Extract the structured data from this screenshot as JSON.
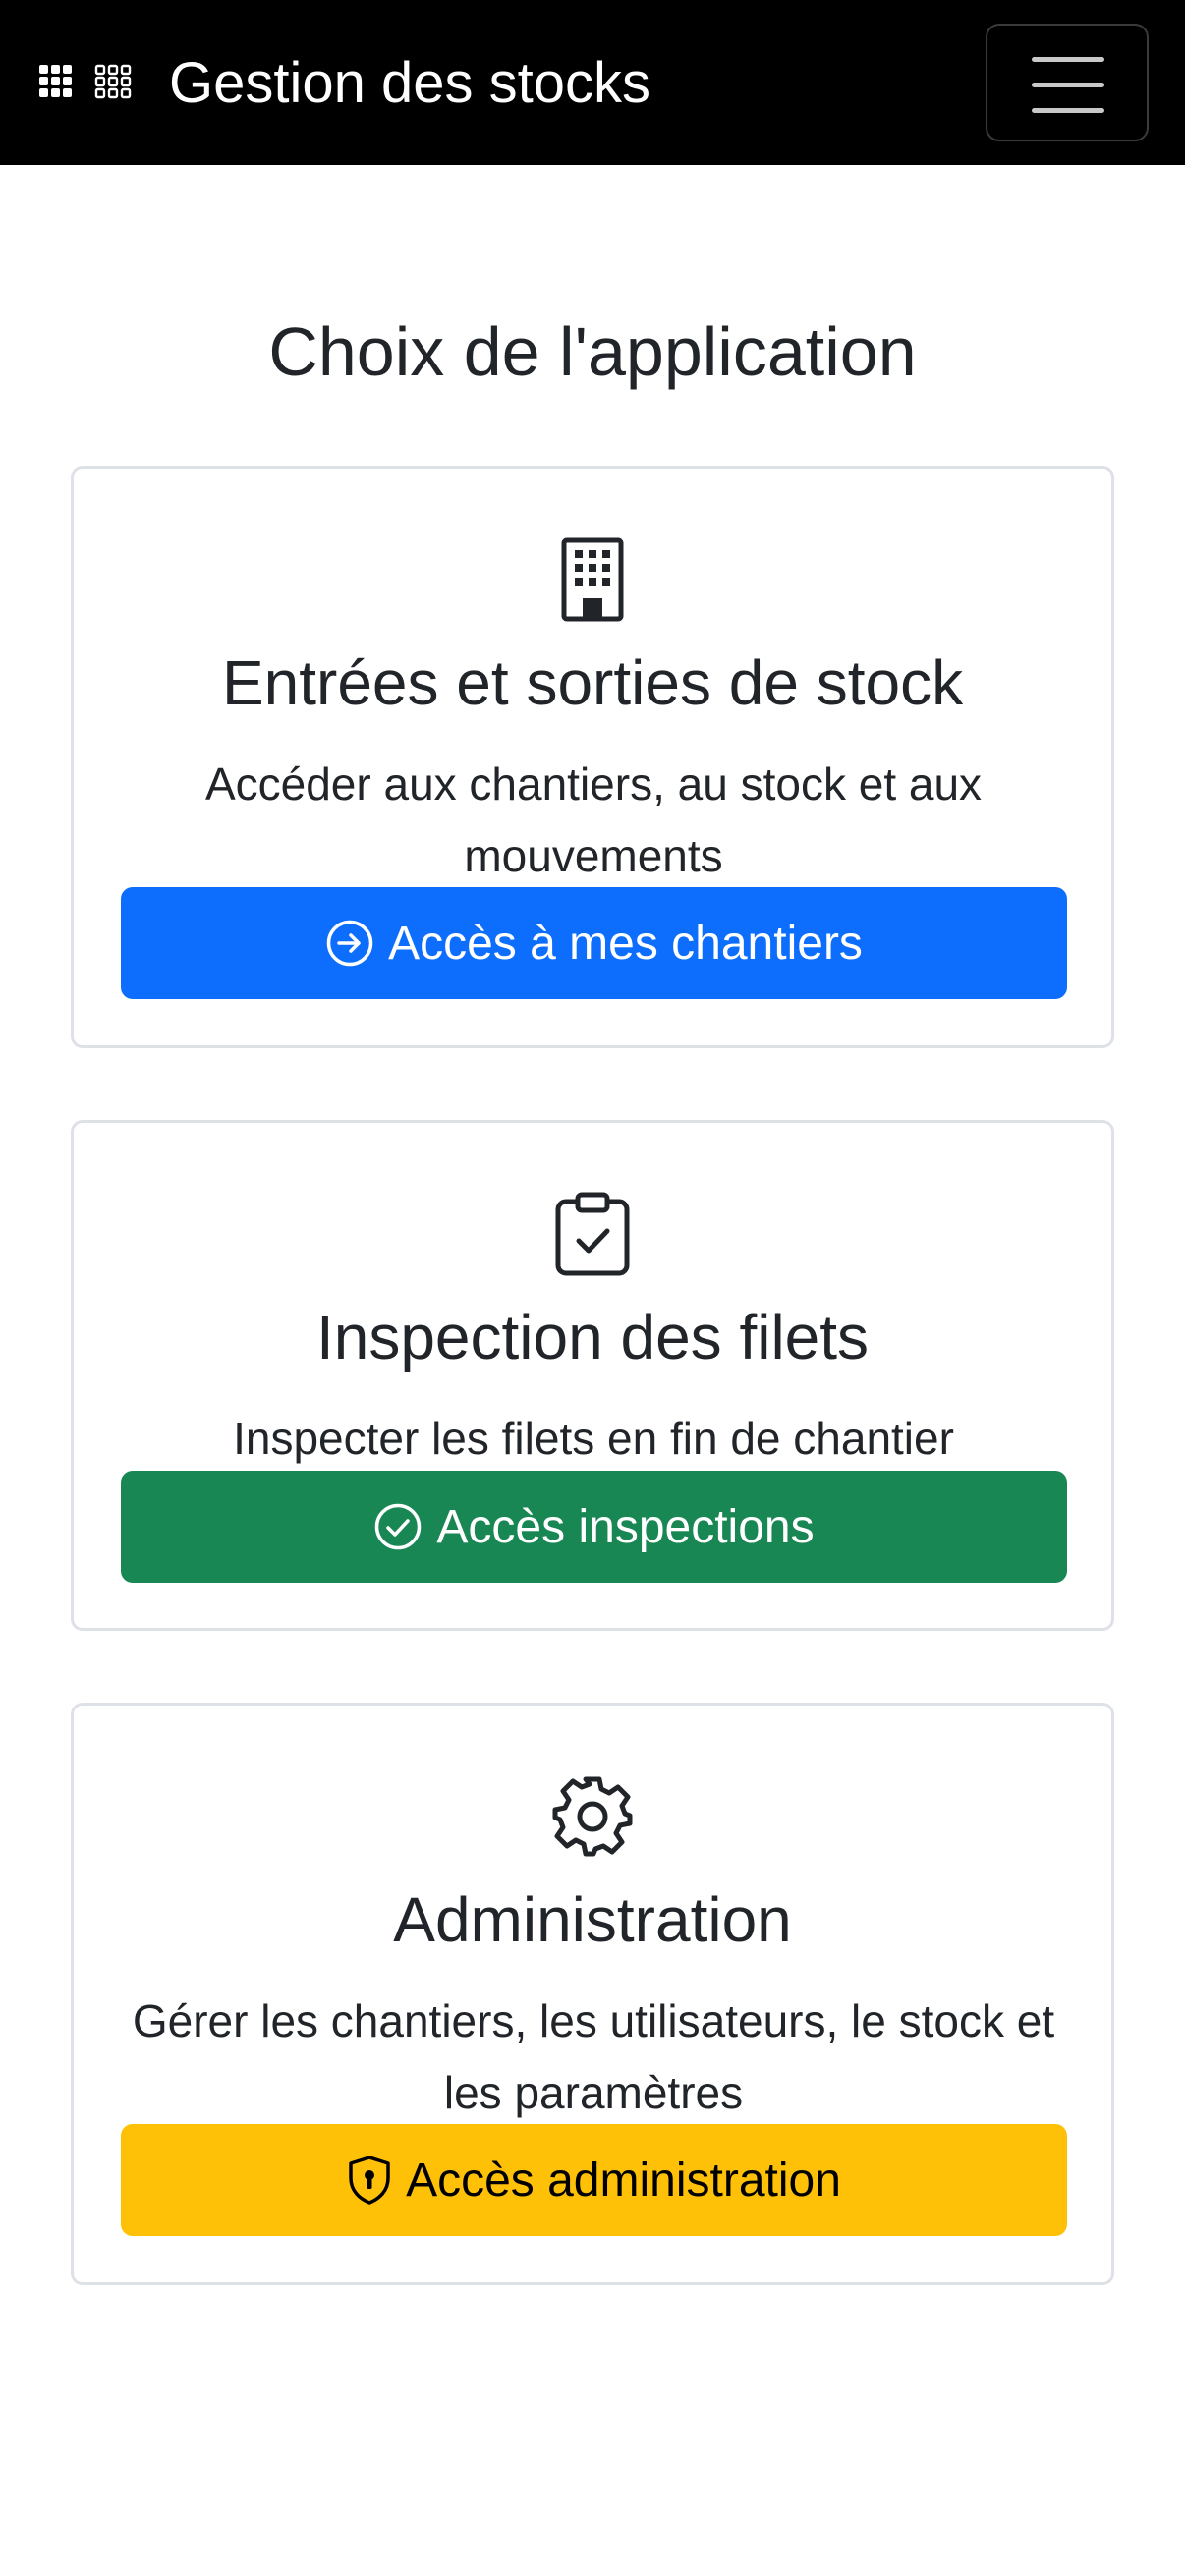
{
  "navbar": {
    "brand_icon": "grid-icon",
    "brand": "Gestion des stocks",
    "menu_icon": "hamburger-icon",
    "background": "#000000"
  },
  "main": {
    "title": "Choix de l'application",
    "cards": [
      {
        "icon": "building-icon",
        "title": "Entrées et sorties de stock",
        "description": "Accéder aux chantiers, au stock et aux mouvements",
        "button_icon": "arrow-right-circle-icon",
        "button": "Accès à mes chantiers",
        "button_color": "#0d6efd"
      },
      {
        "icon": "clipboard-check-icon",
        "title": "Inspection des filets",
        "description": "Inspecter les filets en fin de chantier",
        "button_icon": "check-circle-icon",
        "button": "Accès inspections",
        "button_color": "#198754"
      },
      {
        "icon": "gear-icon",
        "title": "Administration",
        "description": "Gérer les chantiers, les utilisateurs, le stock et les paramètres",
        "button_icon": "shield-lock-icon",
        "button": "Accès administration",
        "button_color": "#ffc107"
      }
    ]
  }
}
